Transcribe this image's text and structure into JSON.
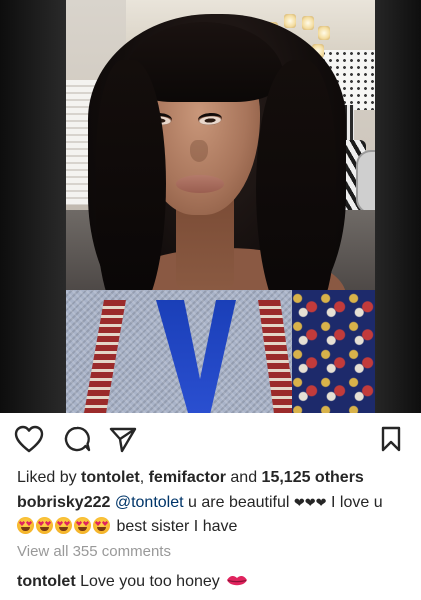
{
  "post": {
    "image_alt": "Photo of a woman with long dark wavy hair",
    "actions": {
      "like_icon": "heart-outline-icon",
      "comment_icon": "comment-bubble-icon",
      "share_icon": "paper-plane-icon",
      "save_icon": "bookmark-icon"
    },
    "likes": {
      "prefix": "Liked by ",
      "user1": "tontolet",
      "separator": ", ",
      "user2": "femifactor",
      "connector": " and ",
      "count_text": "15,125 others"
    },
    "caption": {
      "username": "bobrisky222",
      "mention": "@tontolet",
      "text1": " u are beautiful ",
      "hearts": "❤❤❤",
      "text2": " I love u",
      "emoji_icon": "heart-eyes-emoji",
      "text3": " best sister I have"
    },
    "view_comments": "View all 355 comments",
    "top_comment": {
      "username": "tontolet",
      "text": " Love you too honey",
      "emoji_icon": "kiss-lips-emoji"
    }
  },
  "colors": {
    "text": "#262626",
    "mention": "#003569",
    "muted": "#999999",
    "heart_red": "#e0245e"
  }
}
